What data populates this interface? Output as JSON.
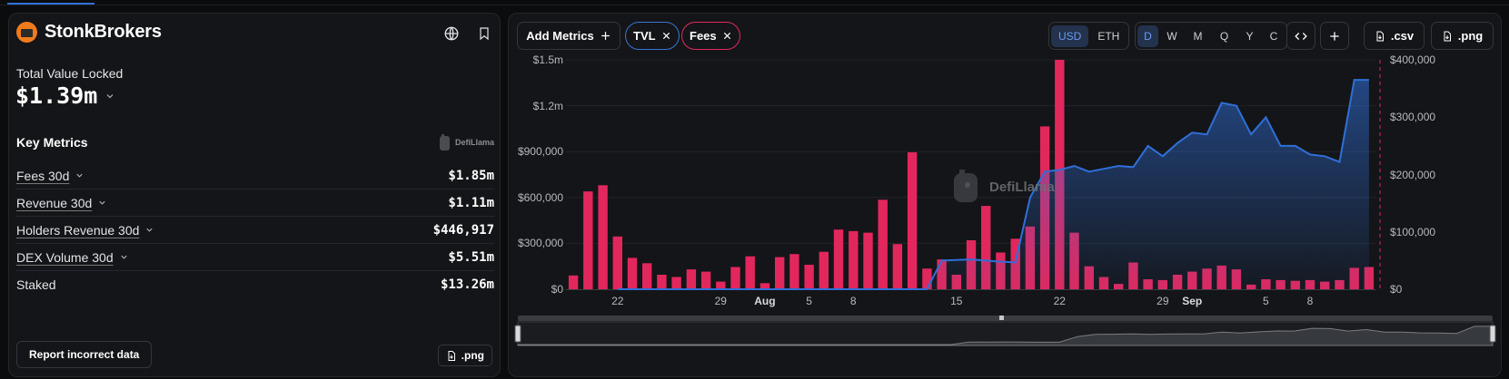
{
  "protocol": {
    "name": "StonkBrokers",
    "tvl_label": "Total Value Locked",
    "tvl_value": "$1.39m",
    "key_metrics_title": "Key Metrics",
    "watermark": "DefiLlama",
    "metrics": [
      {
        "label": "Fees 30d",
        "value": "$1.85m",
        "has_dropdown": true
      },
      {
        "label": "Revenue 30d",
        "value": "$1.11m",
        "has_dropdown": true
      },
      {
        "label": "Holders Revenue 30d",
        "value": "$446,917",
        "has_dropdown": true
      },
      {
        "label": "DEX Volume 30d",
        "value": "$5.51m",
        "has_dropdown": true
      },
      {
        "label": "Staked",
        "value": "$13.26m",
        "has_dropdown": false
      }
    ],
    "report_label": "Report incorrect data",
    "png_label": ".png"
  },
  "toolbar": {
    "add_metrics": "Add Metrics",
    "pills": [
      {
        "label": "TVL",
        "color": "#3b74d6"
      },
      {
        "label": "Fees",
        "color": "#e2275d"
      }
    ],
    "currency": [
      "USD",
      "ETH"
    ],
    "currency_active": "USD",
    "periods": [
      "D",
      "W",
      "M",
      "Q",
      "Y",
      "C"
    ],
    "period_active": "D",
    "csv_label": ".csv",
    "png_label": ".png",
    "icons": [
      "embed-icon",
      "plus-icon"
    ]
  },
  "chart_data": {
    "type": "bar",
    "title": "",
    "watermark": "DefiLlama",
    "colors": {
      "fees": "#e2275d",
      "tvl": "#2f6fd8"
    },
    "x_tick_labels": [
      "22",
      "29",
      "Aug",
      "5",
      "8",
      "15",
      "22",
      "29",
      "Sep",
      "5",
      "8"
    ],
    "left_axis": {
      "ticks": [
        "$0",
        "$300,000",
        "$600,000",
        "$900,000",
        "$1.2m",
        "$1.5m"
      ],
      "ylim": [
        0,
        1500000
      ]
    },
    "right_axis": {
      "ticks": [
        "$0",
        "$100,000",
        "$200,000",
        "$300,000",
        "$400,000"
      ],
      "ylim": [
        0,
        400000
      ]
    },
    "grid": true,
    "series": [
      {
        "name": "Fees",
        "type": "bar",
        "axis": "left",
        "values": [
          90000,
          640000,
          680000,
          345000,
          205000,
          170000,
          95000,
          80000,
          130000,
          115000,
          50000,
          145000,
          215000,
          40000,
          210000,
          230000,
          160000,
          245000,
          390000,
          380000,
          370000,
          585000,
          295000,
          895000,
          135000,
          195000,
          95000,
          320000,
          545000,
          240000,
          330000,
          410000,
          1065000,
          1500000,
          370000,
          150000,
          80000,
          35000,
          175000,
          65000,
          60000,
          95000,
          115000,
          135000,
          155000,
          130000,
          30000,
          65000,
          60000,
          55000,
          60000,
          50000,
          60000,
          140000,
          145000
        ]
      },
      {
        "name": "TVL",
        "type": "area",
        "axis": "right",
        "values": [
          null,
          null,
          null,
          0,
          0,
          0,
          0,
          0,
          0,
          0,
          0,
          0,
          0,
          0,
          0,
          0,
          0,
          0,
          0,
          0,
          0,
          0,
          0,
          0,
          0,
          50000,
          51000,
          52000,
          50000,
          48000,
          47000,
          160000,
          205000,
          208000,
          215000,
          205000,
          210000,
          215000,
          213000,
          250000,
          232000,
          255000,
          273000,
          270000,
          325000,
          320000,
          270000,
          300000,
          250000,
          250000,
          235000,
          232000,
          222000,
          365000,
          365000
        ]
      }
    ]
  }
}
